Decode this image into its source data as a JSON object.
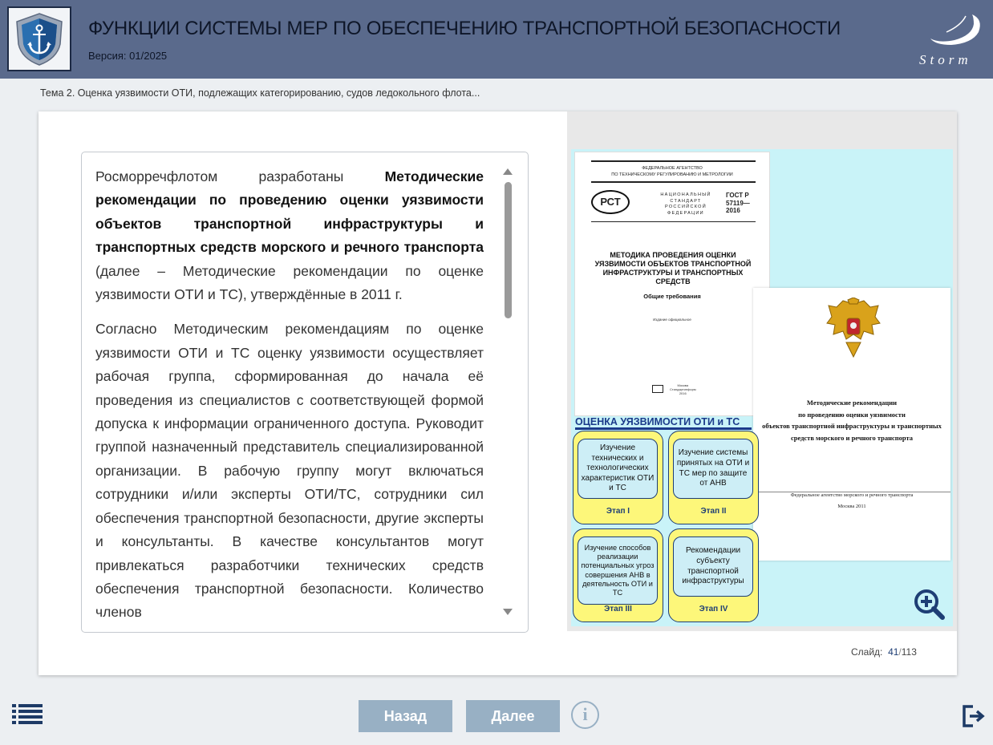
{
  "header": {
    "title": "ФУНКЦИИ СИСТЕМЫ МЕР ПО ОБЕСПЕЧЕНИЮ ТРАНСПОРТНОЙ БЕЗОПАСНОСТИ",
    "version": "Версия: 01/2025",
    "brand": "Storm"
  },
  "breadcrumb": "Тема 2. Оценка уязвимости ОТИ, подлежащих категорированию, судов ледокольного флота...",
  "content": {
    "p1_intro": "Росморречфлотом разработаны ",
    "p1_bold": "Методические рекомендации по проведению оценки уязвимости объектов транспортной инфраструктуры и транспортных средств морского и речного транспорта",
    "p1_rest": " (далее – Методические рекомендации по оценке уязвимости ОТИ и ТС), утверждённые в 2011 г.",
    "p2": "Согласно Методическим рекомендациям по оценке уязвимости ОТИ и ТС оценку уязвимости осуществляет рабочая группа, сформированная до начала её проведения из специалистов с соответствующей формой допуска к информации ограниченного доступа. Руководит группой назначенный представитель специализированной организации. В рабочую группу могут включаться сотрудники и/или эксперты ОТИ/ТС, сотрудники сил обеспечения транспортной безопасности, другие эксперты и консультанты. В качестве консультантов могут привлекаться разработчики технических средств обеспечения транспортной безопасности. Количество членов"
  },
  "figure": {
    "gost": {
      "agency": "ФЕДЕРАЛЬНОЕ АГЕНТСТВО\nПО ТЕХНИЧЕСКОМУ РЕГУЛИРОВАНИЮ И МЕТРОЛОГИИ",
      "emblem": "РСТ",
      "standard": "НАЦИОНАЛЬНЫЙ\nСТАНДАРТ\nРОССИЙСКОЙ\nФЕДЕРАЦИИ",
      "number": "ГОСТ Р\n57119—\n2016",
      "title": "МЕТОДИКА ПРОВЕДЕНИЯ ОЦЕНКИ УЯЗВИМОСТИ ОБЪЕКТОВ ТРАНСПОРТНОЙ ИНФРАСТРУКТУРЫ И ТРАНСПОРТНЫХ СРЕДСТВ",
      "subtitle": "Общие требования",
      "edition": "Издание официальное",
      "publisher": "Москва\nСтандартинформ\n2016"
    },
    "method": {
      "title": "Методические рекомендации\nпо проведению оценки уязвимости\nобъектов транспортной инфраструктуры и транспортных\nсредств морского и речного транспорта",
      "agency": "Федеральное агентство морского и речного транспорта",
      "city": "Москва 2011"
    },
    "assessment_title": "ОЦЕНКА УЯЗВИМОСТИ ОТИ и ТС",
    "stages": [
      {
        "text": "Изучение технических и технологических характеристик ОТИ и ТС",
        "label": "Этап I"
      },
      {
        "text": "Изучение системы принятых на ОТИ и ТС мер по защите от АНВ",
        "label": "Этап II"
      },
      {
        "text": "Изучение способов реализации потенциальных угроз совершения АНВ в деятельность ОТИ и ТС",
        "label": "Этап III"
      },
      {
        "text": "Рекомендации субъекту транспортной инфраструктуры",
        "label": "Этап IV"
      }
    ]
  },
  "slide": {
    "label": "Слайд:",
    "current": "41",
    "separator": "/",
    "total": "113"
  },
  "nav": {
    "back": "Назад",
    "next": "Далее",
    "info": "i"
  },
  "icons": {
    "logo": "anchor-shield-icon",
    "zoom": "zoom-in-icon",
    "menu": "list-menu-icon",
    "exit": "exit-icon"
  },
  "colors": {
    "header_bg": "#5a6a8c",
    "button_bg": "#98b0c4",
    "figure_bg": "#c9f3f8",
    "stage_fill": "#fdf77a",
    "accent": "#1e3e75"
  }
}
